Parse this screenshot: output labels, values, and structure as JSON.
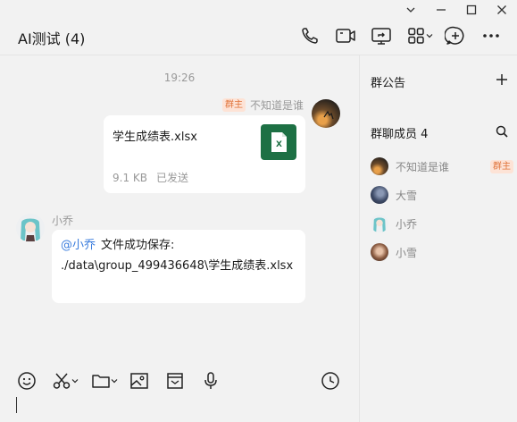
{
  "window": {
    "minimize": "—",
    "maximize": "☐",
    "close": "✕"
  },
  "header": {
    "title": "AI测试 (4)",
    "icons": [
      "phone-icon",
      "video-icon",
      "screen-share-icon",
      "apps-icon",
      "chat-plus-icon",
      "more-icon"
    ]
  },
  "chat": {
    "timestamp": "19:26",
    "messages": [
      {
        "sender": "不知道是谁",
        "badge": "群主",
        "file_name": "学生成绩表.xlsx",
        "file_size": "9.1 KB",
        "file_status": "已发送",
        "file_icon_letter": "X"
      },
      {
        "sender": "小乔",
        "mention": "@小乔",
        "text": "文件成功保存: ./data\\group_499436648\\学生成绩表.xlsx"
      }
    ]
  },
  "toolbar": {
    "icons": [
      "emoji-icon",
      "scissors-icon",
      "folder-icon",
      "image-icon",
      "envelope-icon",
      "mic-icon",
      "history-icon"
    ]
  },
  "sidebar": {
    "announcement_label": "群公告",
    "members_label": "群聊成员 4",
    "members": [
      {
        "name": "不知道是谁",
        "badge": "群主"
      },
      {
        "name": "大雪",
        "badge": ""
      },
      {
        "name": "小乔",
        "badge": ""
      },
      {
        "name": "小雪",
        "badge": ""
      }
    ]
  },
  "colors": {
    "accent": "#3b7ddd",
    "excel": "#1d7044",
    "badge_bg": "#fde3d6",
    "badge_text": "#e0733a"
  }
}
